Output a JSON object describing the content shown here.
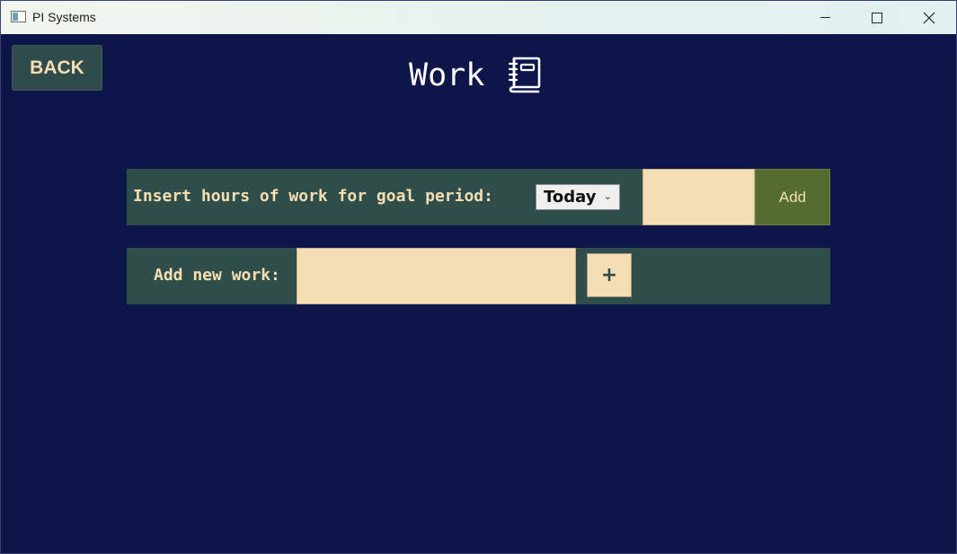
{
  "window": {
    "title": "PI Systems",
    "controls": [
      "minimize",
      "maximize",
      "close"
    ]
  },
  "header": {
    "back_label": "BACK",
    "title": "Work",
    "title_icon": "notebook-icon"
  },
  "hours_row": {
    "label": "Insert hours of work for goal period:",
    "period_selected": "Today",
    "hours_value": "",
    "add_label": "Add"
  },
  "new_work_row": {
    "label": "Add new work:",
    "work_value": "",
    "plus_label": "+"
  },
  "colors": {
    "background": "#0e1649",
    "panel": "#2e4d4b",
    "input": "#f5deb3",
    "accent_text": "#f6deb1",
    "add_button": "#556b2f"
  }
}
